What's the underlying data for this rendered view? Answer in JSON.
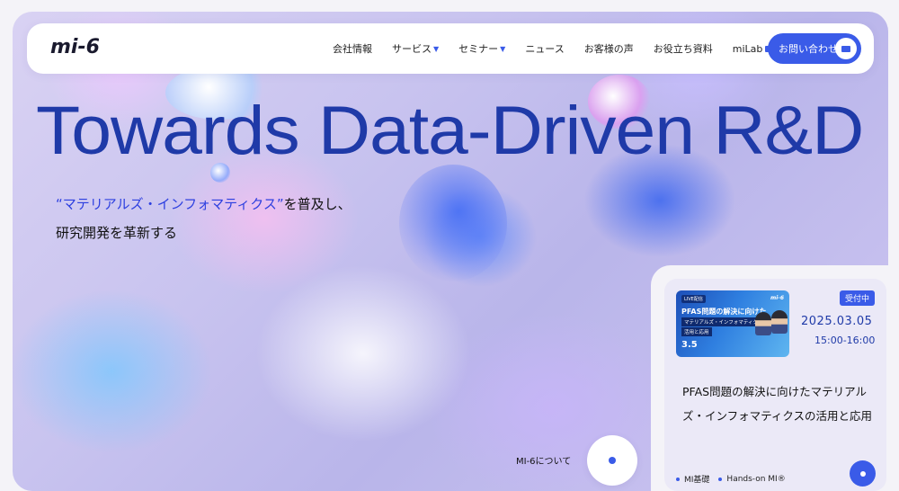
{
  "brand": {
    "logo_text": "mi-6"
  },
  "nav": {
    "items": [
      {
        "label": "会社情報",
        "has_dropdown": false
      },
      {
        "label": "サービス",
        "has_dropdown": true
      },
      {
        "label": "セミナー",
        "has_dropdown": true
      },
      {
        "label": "ニュース",
        "has_dropdown": false
      },
      {
        "label": "お客様の声",
        "has_dropdown": false
      },
      {
        "label": "お役立ち資料",
        "has_dropdown": false
      },
      {
        "label": "miLab",
        "external": true
      }
    ],
    "contact_label": "お問い合わせ"
  },
  "hero": {
    "headline": "Towards Data-Driven R&D",
    "subtitle_accent": "“マテリアルズ・インフォマティクス”",
    "subtitle_rest": "を普及し、",
    "subtitle_line2": "研究開発を革新する",
    "about_label": "MI-6について"
  },
  "event_card": {
    "thumbnail": {
      "tag": "LIVE配信",
      "brand": "mi-6",
      "title_line1": "PFAS問題の解決に向けた",
      "title_line2": "マテリアルズ・インフォマティクスの",
      "title_line3": "活用と応用",
      "date": "3.5"
    },
    "status_badge": "受付中",
    "date": "2025.03.05",
    "time": "15:00-16:00",
    "title": "PFAS問題の解決に向けたマテリアルズ・インフォマティクスの活用と応用",
    "tags": [
      "MI基礎",
      "Hands-on MI®"
    ]
  },
  "colors": {
    "accent": "#3a5be8",
    "headline": "#1f3aa8"
  }
}
